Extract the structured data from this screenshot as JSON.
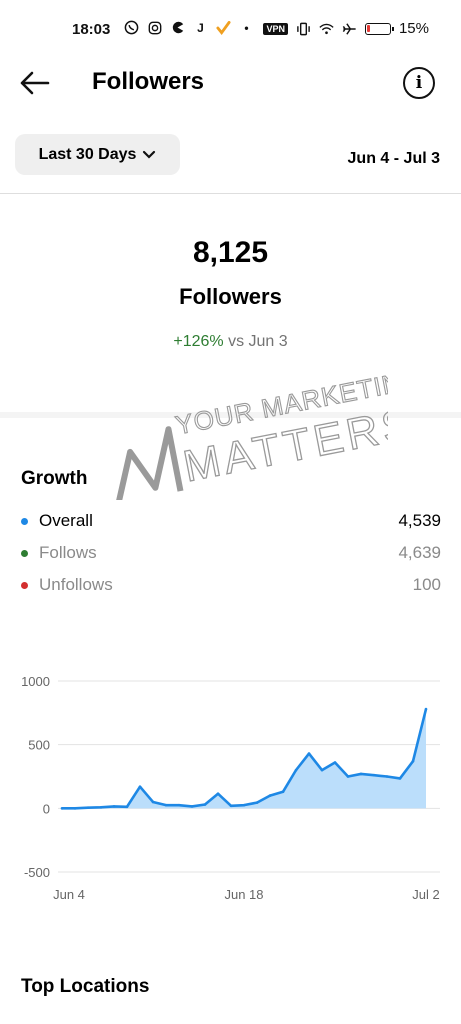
{
  "status_bar": {
    "time": "18:03",
    "vpn": "VPN",
    "battery_pct": "15%",
    "battery_level": 0.15,
    "icons": [
      "whatsapp-icon",
      "instagram-icon",
      "pacman-icon",
      "j-app-icon",
      "check-app-icon",
      "dot-icon"
    ]
  },
  "header": {
    "title": "Followers"
  },
  "filter": {
    "range_label": "Last 30 Days",
    "date_range": "Jun 4 - Jul 3"
  },
  "summary": {
    "count": "8,125",
    "label": "Followers",
    "change": "+126%",
    "change_suffix": "vs Jun 3"
  },
  "watermark": {
    "line1": "YOUR MARKETING",
    "line2": "MATTERS"
  },
  "growth": {
    "title": "Growth",
    "items": [
      {
        "label": "Overall",
        "value": "4,539",
        "color": "#1e88e5"
      },
      {
        "label": "Follows",
        "value": "4,639",
        "color": "#2e7d32"
      },
      {
        "label": "Unfollows",
        "value": "100",
        "color": "#d32f2f"
      }
    ]
  },
  "chart_data": {
    "type": "area",
    "x_tick_labels": [
      "Jun 4",
      "Jun 18",
      "Jul 2"
    ],
    "y_tick_labels": [
      "1000",
      "500",
      "0",
      "-500"
    ],
    "ylim": [
      -500,
      1000
    ],
    "values": [
      0,
      0,
      5,
      8,
      15,
      12,
      170,
      50,
      25,
      25,
      15,
      30,
      115,
      20,
      25,
      45,
      100,
      130,
      300,
      430,
      300,
      360,
      250,
      270,
      260,
      250,
      235,
      370,
      780
    ],
    "line_color": "#1e88e5",
    "fill_color": "#bbdefb",
    "grid": true
  },
  "locations": {
    "title": "Top Locations"
  }
}
